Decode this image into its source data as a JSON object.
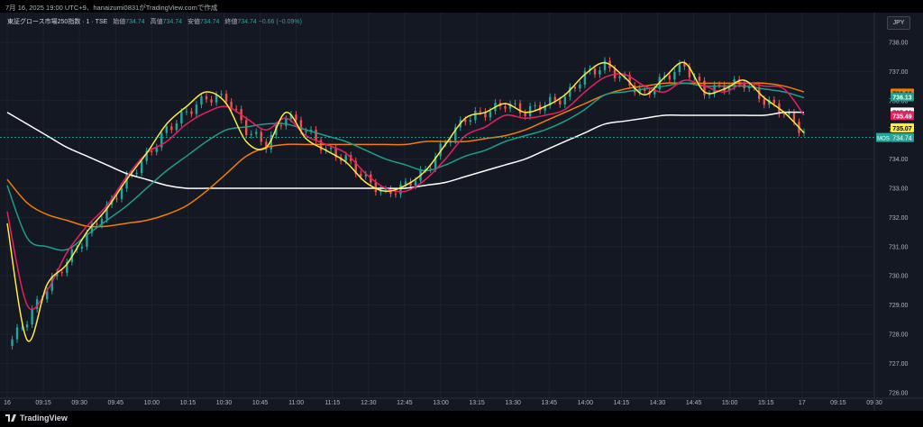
{
  "caption": "7月 16, 2025 19:00 UTC+9、hanaizumi0831がTradingView.comで作成",
  "legend": {
    "symbol": "東証グロース市場250指数 · 1 · TSE",
    "open_label": "始値",
    "open": "734.74",
    "high_label": "高値",
    "high": "734.74",
    "low_label": "安値",
    "low": "734.74",
    "close_label": "終値",
    "close": "734.74",
    "change": "−0.66 (−0.09%)"
  },
  "currency": "JPY",
  "branding": "TradingView",
  "colors": {
    "background": "#141823",
    "up_candle": "#26a69a",
    "down_candle": "#ef5350",
    "axis_text": "#b2b5be",
    "grid": "#1e222d"
  },
  "chart_data": {
    "type": "line",
    "y_ticks": [
      "738.00",
      "737.00",
      "736.00",
      "735.00",
      "734.00",
      "733.00",
      "732.00",
      "731.00",
      "730.00",
      "729.00",
      "728.00",
      "727.00",
      "726.00"
    ],
    "x_ticks": [
      "16",
      "09:15",
      "09:30",
      "09:45",
      "10:00",
      "10:15",
      "10:30",
      "10:45",
      "11:00",
      "11:15",
      "12:30",
      "12:45",
      "13:00",
      "13:15",
      "13:30",
      "13:45",
      "14:00",
      "14:15",
      "14:30",
      "14:45",
      "15:00",
      "15:15",
      "17",
      "09:15",
      "09:30"
    ],
    "ylim": [
      725.9,
      738.4
    ],
    "grid": true,
    "candles_close": [
      727.6,
      728.5,
      729.6,
      730.5,
      731.4,
      732.3,
      733.3,
      734.1,
      735.0,
      735.6,
      736.1,
      736.1,
      735.0,
      734.5,
      735.5,
      735.0,
      734.3,
      734.0,
      733.3,
      732.8,
      733.1,
      733.6,
      734.6,
      735.4,
      735.6,
      735.9,
      735.6,
      735.9,
      736.1,
      736.9,
      737.2,
      736.7,
      736.2,
      736.8,
      737.2,
      736.3,
      736.5,
      736.6,
      736.0,
      735.6,
      734.9
    ],
    "series": [
      {
        "color": "#ffeb3b",
        "values": [
          731.8,
          727.8,
          729.7,
          730.4,
          731.5,
          732.3,
          733.3,
          734.2,
          735.2,
          735.8,
          736.3,
          735.9,
          734.6,
          734.4,
          735.6,
          734.7,
          734.3,
          733.9,
          733.2,
          732.9,
          733.1,
          733.6,
          734.5,
          735.4,
          735.6,
          735.9,
          735.6,
          735.8,
          736.2,
          736.9,
          737.3,
          736.8,
          736.2,
          736.8,
          737.3,
          736.3,
          736.4,
          736.7,
          736.1,
          735.6,
          734.9
        ]
      },
      {
        "color": "#e91e63",
        "values": [
          732.2,
          729.0,
          729.5,
          730.8,
          731.7,
          732.4,
          733.4,
          734.2,
          734.6,
          735.2,
          735.6,
          735.8,
          735.4,
          735.0,
          735.4,
          734.8,
          734.5,
          734.2,
          733.5,
          733.0,
          732.9,
          733.3,
          734.0,
          734.8,
          735.1,
          735.5,
          735.4,
          735.5,
          735.7,
          736.3,
          736.8,
          736.9,
          736.5,
          736.3,
          736.7,
          736.5,
          736.3,
          736.6,
          736.5,
          736.4,
          735.5
        ]
      },
      {
        "color": "#1e9e8c",
        "values": [
          733.1,
          731.3,
          731.0,
          730.9,
          731.4,
          731.9,
          732.4,
          733.0,
          733.6,
          734.1,
          734.6,
          735.0,
          735.1,
          735.2,
          735.2,
          735.0,
          734.8,
          734.6,
          734.3,
          734.0,
          733.8,
          733.6,
          733.8,
          734.1,
          734.3,
          734.6,
          734.8,
          735.0,
          735.3,
          735.7,
          736.2,
          736.3,
          736.4,
          736.5,
          736.6,
          736.5,
          736.5,
          736.5,
          736.4,
          736.3,
          736.1
        ]
      },
      {
        "color": "#f57c00",
        "values": [
          733.3,
          732.5,
          732.1,
          731.9,
          731.7,
          731.7,
          731.8,
          731.9,
          732.1,
          732.4,
          732.9,
          733.5,
          734.1,
          734.4,
          734.5,
          734.5,
          734.5,
          734.5,
          734.5,
          734.5,
          734.5,
          734.6,
          734.6,
          734.6,
          734.7,
          734.8,
          735.0,
          735.3,
          735.6,
          735.9,
          736.2,
          736.4,
          736.5,
          736.6,
          736.6,
          736.6,
          736.6,
          736.6,
          736.6,
          736.5,
          736.3
        ]
      },
      {
        "color": "#ffffff",
        "values": [
          735.6,
          735.2,
          734.8,
          734.4,
          734.1,
          733.8,
          733.5,
          733.3,
          733.1,
          733.0,
          733.0,
          733.0,
          733.0,
          733.0,
          733.0,
          733.0,
          733.0,
          733.0,
          733.0,
          733.0,
          733.0,
          733.1,
          733.2,
          733.4,
          733.6,
          733.8,
          734.0,
          734.3,
          734.6,
          734.9,
          735.2,
          735.3,
          735.4,
          735.5,
          735.5,
          735.5,
          735.5,
          735.5,
          735.5,
          735.6,
          735.6
        ]
      }
    ],
    "price_labels": [
      {
        "text": "736.26",
        "bg": "#f57c00",
        "fg": "#000000",
        "y": 736.26
      },
      {
        "text": "736.13",
        "bg": "#1e9e8c",
        "fg": "#ffffff",
        "y": 736.13
      },
      {
        "text": "735.61",
        "bg": "#ffffff",
        "fg": "#000000",
        "y": 735.61
      },
      {
        "text": "735.49",
        "bg": "#e91e63",
        "fg": "#ffffff",
        "y": 735.49
      },
      {
        "text": "735.07",
        "bg": "#ffeb3b",
        "fg": "#000000",
        "y": 735.07
      }
    ],
    "last_price": {
      "symbol": "MOS",
      "value": "734.74",
      "y": 734.74,
      "color": "#26a69a"
    }
  }
}
